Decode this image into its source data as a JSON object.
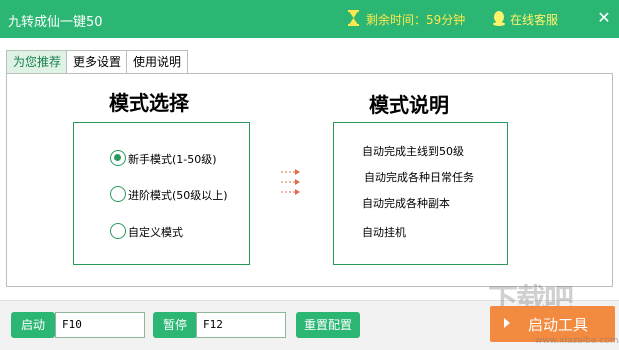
{
  "window": {
    "title": "九转成仙一键50",
    "timer_text": "剩余时间：59分钟",
    "support_label": "在线客服",
    "close_glyph": "✕"
  },
  "tabs": [
    {
      "label": "为您推荐",
      "active": true
    },
    {
      "label": "更多设置",
      "active": false
    },
    {
      "label": "使用说明",
      "active": false
    }
  ],
  "mode_select": {
    "title": "模式选择",
    "options": [
      {
        "label": "新手模式(1-50级)",
        "checked": true
      },
      {
        "label": "进阶模式(50级以上)",
        "checked": false
      },
      {
        "label": "自定义模式",
        "checked": false
      }
    ]
  },
  "mode_desc": {
    "title": "模式说明",
    "lines": [
      "自动完成主线到50级",
      "自动完成各种日常任务",
      "自动完成各种副本",
      "自动挂机"
    ]
  },
  "bottom": {
    "start_label": "启动",
    "start_hotkey": "F10",
    "pause_label": "暂停",
    "pause_hotkey": "F12",
    "reset_label": "重置配置",
    "tool_label": "启动工具"
  },
  "watermark": {
    "text": "下载吧",
    "sub": "www.xiazaiba.com"
  },
  "colors": {
    "brand_green": "#2bb673",
    "accent_orange": "#f28a3f",
    "timer_yellow": "#ffe84d"
  }
}
